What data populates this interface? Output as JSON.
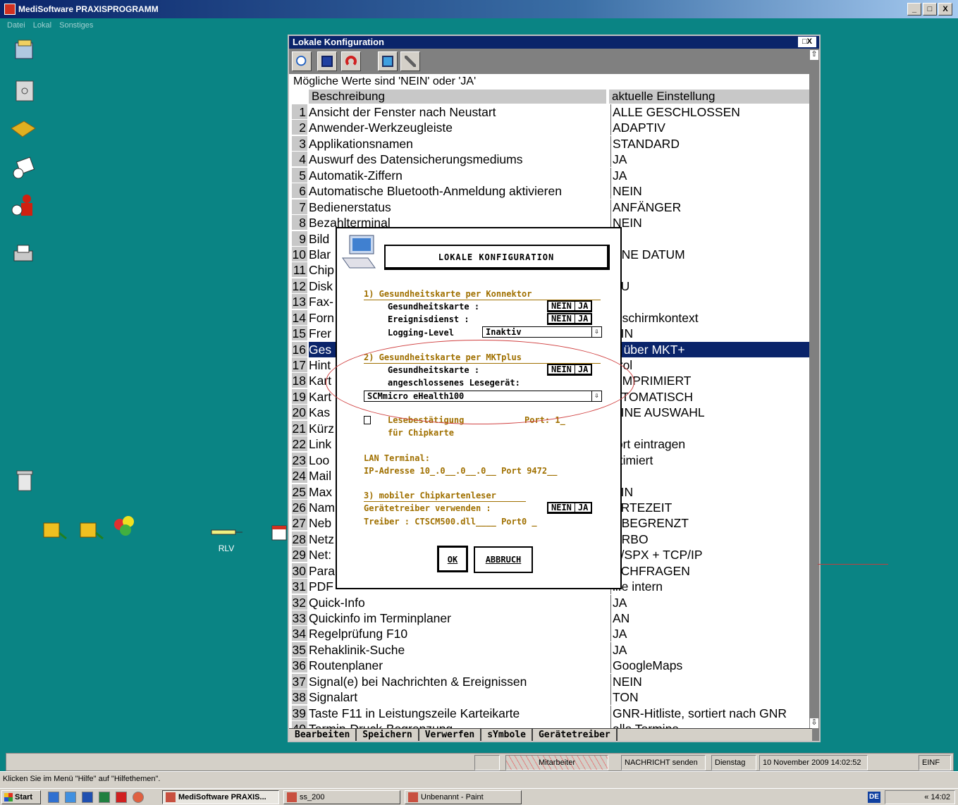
{
  "app": {
    "title": "MediSoftware PRAXISPROGRAMM",
    "menu": [
      "Datei",
      "Lokal",
      "Sonstiges"
    ],
    "buttons": {
      "minimize": "_",
      "maximize": "□",
      "close": "X"
    }
  },
  "config_window": {
    "title": "Lokale Konfiguration",
    "close": "□X",
    "hint": "Mögliche Werte sind 'NEIN' oder 'JA'",
    "col_desc": "Beschreibung",
    "col_value": "aktuelle Einstellung",
    "scroll_up": "⇧",
    "scroll_down": "⇩",
    "rows": [
      {
        "n": "1",
        "desc": "Ansicht der Fenster nach Neustart",
        "val": "ALLE GESCHLOSSEN"
      },
      {
        "n": "2",
        "desc": "Anwender-Werkzeugleiste",
        "val": "ADAPTIV"
      },
      {
        "n": "3",
        "desc": "Applikationsnamen",
        "val": "STANDARD"
      },
      {
        "n": "4",
        "desc": "Auswurf des Datensicherungsmediums",
        "val": "JA"
      },
      {
        "n": "5",
        "desc": "Automatik-Ziffern",
        "val": "JA"
      },
      {
        "n": "6",
        "desc": "Automatische Bluetooth-Anmeldung aktivieren",
        "val": "NEIN"
      },
      {
        "n": "7",
        "desc": "Bedienerstatus",
        "val": "ANFÄNGER"
      },
      {
        "n": "8",
        "desc": "Bezahlterminal",
        "val": "NEIN"
      },
      {
        "n": "9",
        "desc": "Bild",
        "val": "N"
      },
      {
        "n": "10",
        "desc": "Blar",
        "val": "HNE DATUM"
      },
      {
        "n": "11",
        "desc": "Chip",
        "val": "A"
      },
      {
        "n": "12",
        "desc": "Disk",
        "val": "EU"
      },
      {
        "n": "13",
        "desc": "Fax-",
        "val": "."
      },
      {
        "n": "14",
        "desc": "Forn",
        "val": "ldschirmkontext"
      },
      {
        "n": "15",
        "desc": "Frer",
        "val": "EIN"
      },
      {
        "n": "16",
        "desc": "Ges",
        "val": "A über MKT+",
        "selected": true
      },
      {
        "n": "17",
        "desc": "Hint",
        "val": "ltrol"
      },
      {
        "n": "18",
        "desc": "Kart",
        "val": "OMPRIMIERT"
      },
      {
        "n": "19",
        "desc": "Kart",
        "val": "UTOMATISCH"
      },
      {
        "n": "20",
        "desc": "Kas",
        "val": "EINE AUSWAHL"
      },
      {
        "n": "21",
        "desc": "Kürz",
        "val": "N"
      },
      {
        "n": "22",
        "desc": "Link",
        "val": "fort eintragen"
      },
      {
        "n": "23",
        "desc": "Loo",
        "val": "ptimiert"
      },
      {
        "n": "24",
        "desc": "Mail",
        "val": ""
      },
      {
        "n": "25",
        "desc": "Max",
        "val": "EIN"
      },
      {
        "n": "26",
        "desc": "Nam",
        "val": "ARTEZEIT"
      },
      {
        "n": "27",
        "desc": "Neb",
        "val": "NBEGRENZT"
      },
      {
        "n": "28",
        "desc": "Netz",
        "val": "URBO"
      },
      {
        "n": "29",
        "desc": "Net:",
        "val": "X/SPX + TCP/IP"
      },
      {
        "n": "30",
        "desc": "Para",
        "val": "ACHFRAGEN"
      },
      {
        "n": "31",
        "desc": "PDF",
        "val": "ilfe intern"
      },
      {
        "n": "32",
        "desc": "Quick-Info",
        "val": "JA"
      },
      {
        "n": "33",
        "desc": "Quickinfo im Terminplaner",
        "val": "AN"
      },
      {
        "n": "34",
        "desc": "Regelprüfung F10",
        "val": "JA"
      },
      {
        "n": "35",
        "desc": "Rehaklinik-Suche",
        "val": "JA"
      },
      {
        "n": "36",
        "desc": "Routenplaner",
        "val": "GoogleMaps"
      },
      {
        "n": "37",
        "desc": "Signal(e) bei Nachrichten & Ereignissen",
        "val": "NEIN"
      },
      {
        "n": "38",
        "desc": "Signalart",
        "val": "TON"
      },
      {
        "n": "39",
        "desc": "Taste F11 in Leistungszeile Karteikarte",
        "val": "GNR-Hitliste, sortiert nach GNR"
      },
      {
        "n": "40",
        "desc": "Termin-Druck-Begrenzung",
        "val": "alle Termine"
      }
    ],
    "funcbar": [
      "Bearbeiten",
      "Speichern",
      "Verwerfen",
      "sYmbole",
      "Gerätetreiber"
    ]
  },
  "dialog": {
    "title": "LOKALE KONFIGURATION",
    "s1": {
      "head": "1) Gesundheitskarte per Konnektor",
      "gk": "Gesundheitskarte       :",
      "ed": "Ereignisdienst         :",
      "log": "Logging-Level",
      "log_val": "Inaktiv"
    },
    "s2": {
      "head": "2) Gesundheitskarte per MKTplus",
      "gk": "Gesundheitskarte       :",
      "lese": "angeschlossenes Lesegerät:",
      "device": "SCMmicro eHealth100"
    },
    "lesebest": "Lesebestätigung",
    "port": "Port: 1_",
    "chip": "für Chipkarte",
    "lan": "LAN Terminal:",
    "ip": "IP-Adresse 10_.0__.0__.0__ Port 9472__",
    "s3": {
      "head": "3) mobiler Chipkartenleser",
      "drv": "Gerätetreiber verwenden   :",
      "treiber": "Treiber : CTSCM500.dll____ Port0 _"
    },
    "nein": "NEIN",
    "ja": "JA",
    "arrow": "⇩",
    "ok": "OK",
    "cancel": "ABBRUCH"
  },
  "desktop": {
    "rlv": "RLV"
  },
  "status": {
    "mitarbeiter": "Mitarbeiter",
    "nachricht": "NACHRICHT senden",
    "tag": "Dienstag",
    "datum": "10 November 2009  14:02:52",
    "einf": "EINF"
  },
  "hint": "Klicken Sie im Menü \"Hilfe\" auf \"Hilfethemen\".",
  "taskbar": {
    "start": "Start",
    "tasks": [
      "MediSoftware PRAXIS...",
      "ss_200",
      "Unbenannt - Paint"
    ],
    "lang": "DE",
    "time": "« 14:02"
  }
}
